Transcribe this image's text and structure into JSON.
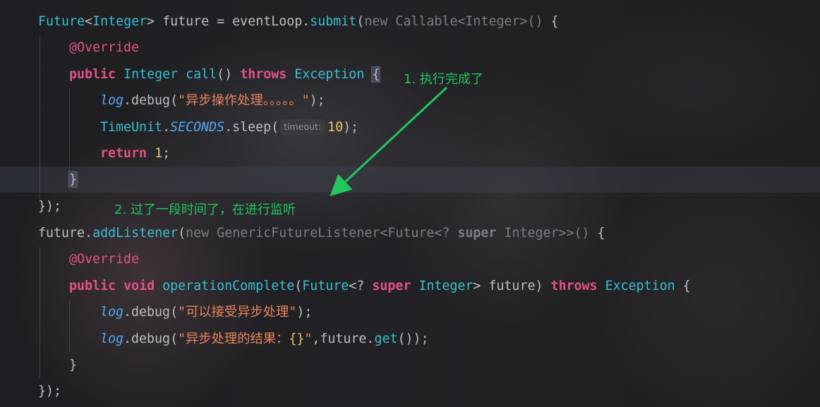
{
  "code": {
    "l1": {
      "t1": "Future",
      "t2": "<",
      "t3": "Integer",
      "t4": "> future = eventLoop.",
      "t5": "submit",
      "t6": "(",
      "t7": "new",
      "t8": " ",
      "t9": "Callable",
      "t10": "<Integer>() ",
      "t11": "{"
    },
    "l2": {
      "t1": "@Override"
    },
    "l3": {
      "t1": "public",
      "t2": " ",
      "t3": "Integer",
      "t4": " ",
      "t5": "call",
      "t6": "() ",
      "t7": "throws",
      "t8": " ",
      "t9": "Exception",
      "t10": " ",
      "t11": "{"
    },
    "l4": {
      "t1": "log",
      "t2": ".debug(",
      "t3": "\"异步操作处理。。。。。\"",
      "t4": ");"
    },
    "l5": {
      "t1": "TimeUnit",
      "t2": ".",
      "t3": "SECONDS",
      "t4": ".sleep(",
      "hint": "timeout:",
      "t5": "10",
      "t6": ");"
    },
    "l6": {
      "t1": "return",
      "t2": " ",
      "t3": "1",
      "t4": ";"
    },
    "l7": {
      "t1": "}"
    },
    "l8": {
      "t1": "});"
    },
    "l9": {
      "t1": "future",
      "t2": ".",
      "t3": "addListener",
      "t4": "(",
      "t5": "new",
      "t6": " ",
      "t7": "GenericFutureListener",
      "t8": "<Future<? ",
      "t9": "super",
      "t10": " Integer>>() ",
      "t11": "{"
    },
    "l10": {
      "t1": "@Override"
    },
    "l11": {
      "t1": "public",
      "t2": " ",
      "t3": "void",
      "t4": " ",
      "t5": "operationComplete",
      "t6": "(",
      "t7": "Future",
      "t8": "<? ",
      "t9": "super",
      "t10": " ",
      "t11": "Integer",
      "t12": "> future) ",
      "t13": "throws",
      "t14": " ",
      "t15": "Exception",
      "t16": " {"
    },
    "l12": {
      "t1": "log",
      "t2": ".debug(",
      "t3": "\"可以接受异步处理\"",
      "t4": ");"
    },
    "l13": {
      "t1": "log",
      "t2": ".debug(",
      "t3": "\"异步处理的结果：",
      "t4": "{}",
      "t5": "\"",
      "t6": ",future.",
      "t7": "get",
      "t8": "());"
    },
    "l14": {
      "t1": "}"
    },
    "l15": {
      "t1": "});"
    }
  },
  "annotations": {
    "step1": "1. 执行完成了",
    "step2": "2. 过了一段时间了，在进行监听"
  },
  "colors": {
    "annotation": "#22c55e",
    "keyword": "#cf8e6d",
    "type": "#56a8f5",
    "annotation_tag": "#e4518a",
    "static_field": "#c77dbb",
    "number": "#e8c46a"
  }
}
